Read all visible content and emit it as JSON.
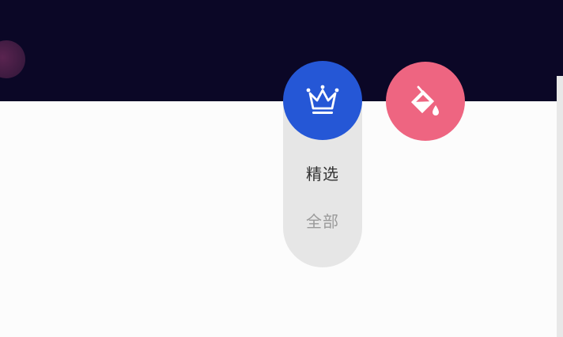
{
  "colors": {
    "banner_bg": "#0b0726",
    "page_bg": "#fcfcfc",
    "crown_button_bg": "#2557d6",
    "paint_button_bg": "#ee6581",
    "pill_bg": "#e6e6e6",
    "selected_text": "#333333",
    "unselected_text": "#9a9a9a"
  },
  "icons": {
    "primary_button": "crown-icon",
    "secondary_button": "paint-bucket-icon"
  },
  "filter_menu": {
    "options": [
      {
        "label": "精选",
        "selected": true
      },
      {
        "label": "全部",
        "selected": false
      }
    ]
  }
}
